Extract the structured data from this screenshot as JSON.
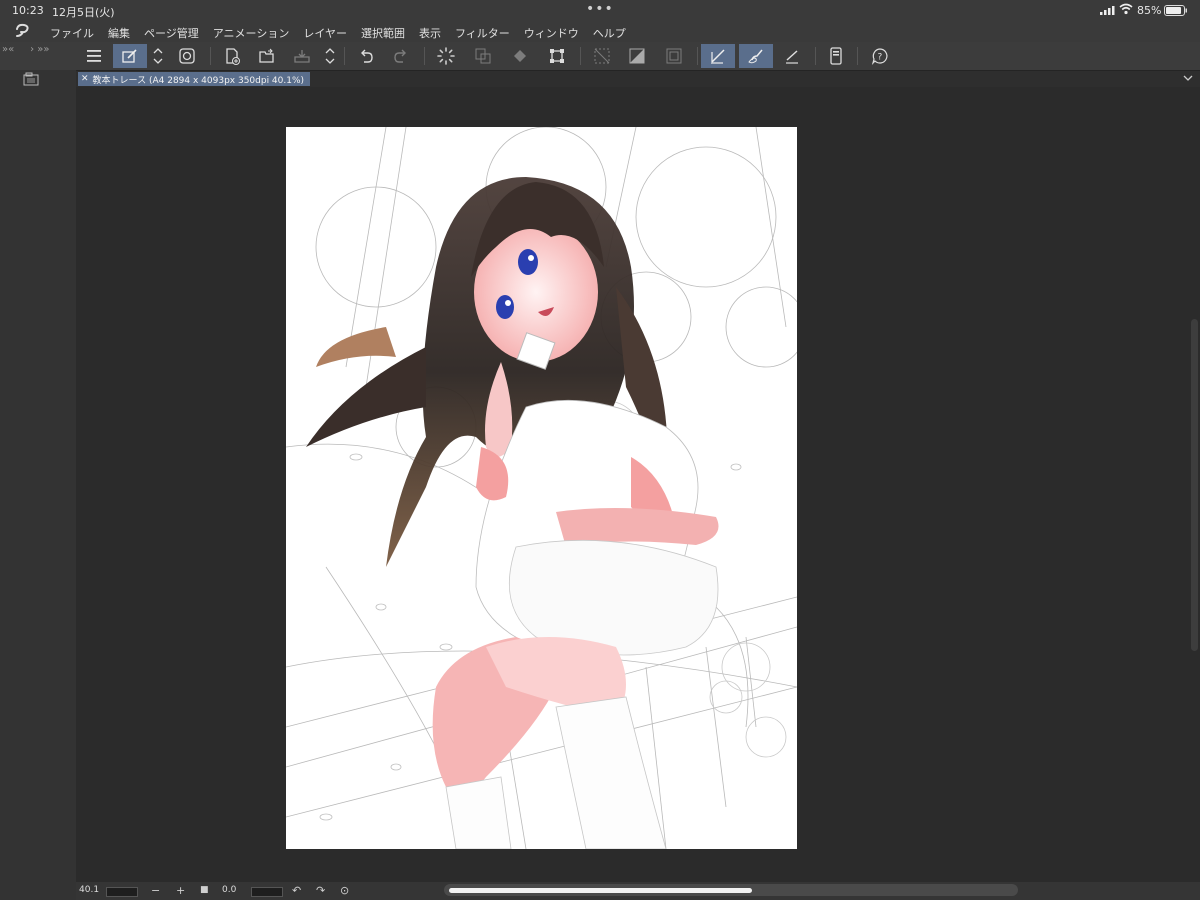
{
  "status": {
    "time": "10:23",
    "date": "12月5日(火)",
    "battery": "85%"
  },
  "menu": {
    "items": [
      "ファイル",
      "編集",
      "ページ管理",
      "アニメーション",
      "レイヤー",
      "選択範囲",
      "表示",
      "フィルター",
      "ウィンドウ",
      "ヘルプ"
    ]
  },
  "document": {
    "tab_title": "教本トレース (A4 2894 x 4093px 350dpi 40.1%)"
  },
  "bottom": {
    "zoom": "40.1",
    "angle": "0.0"
  },
  "colors": {
    "accent": "#5a6e8c",
    "bar": "#3a3a3a",
    "canvas": "#2b2b2b"
  }
}
